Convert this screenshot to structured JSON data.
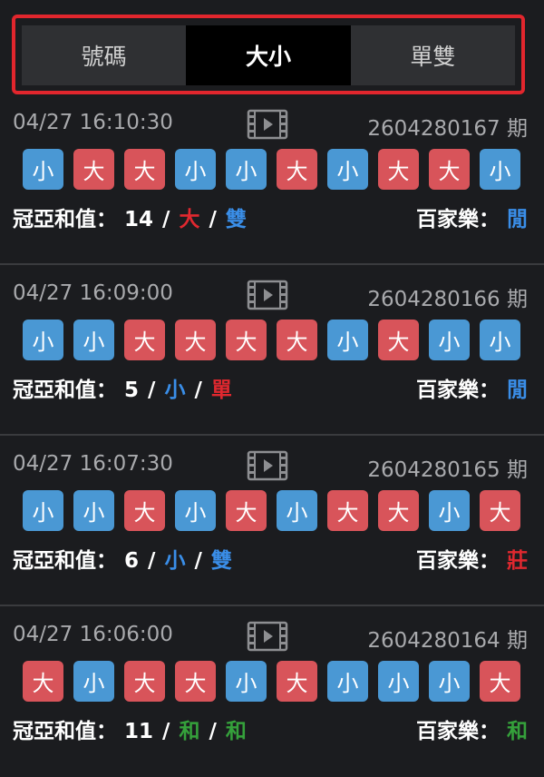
{
  "tabs": [
    {
      "label": "號碼",
      "active": false
    },
    {
      "label": "大小",
      "active": true
    },
    {
      "label": "單雙",
      "active": false
    }
  ],
  "labels": {
    "sum_label": "冠亞和值：",
    "baccarat_label": "百家樂：",
    "period_suffix": "期"
  },
  "colors": {
    "big": "#d8545a",
    "small": "#4a98d4",
    "red_text": "#e0282f",
    "blue_text": "#3a8ee8",
    "green_text": "#35a13b",
    "tab_highlight_border": "#e2262d"
  },
  "rounds": [
    {
      "time": "04/27 16:10:30",
      "period": "2604280167",
      "balls": [
        "小",
        "大",
        "大",
        "小",
        "小",
        "大",
        "小",
        "大",
        "大",
        "小"
      ],
      "sum": "14",
      "size": "大",
      "size_color": "red",
      "parity": "雙",
      "parity_color": "blue",
      "baccarat": "閒",
      "baccarat_color": "blue"
    },
    {
      "time": "04/27 16:09:00",
      "period": "2604280166",
      "balls": [
        "小",
        "小",
        "大",
        "大",
        "大",
        "大",
        "小",
        "大",
        "小",
        "小"
      ],
      "sum": "5",
      "size": "小",
      "size_color": "blue",
      "parity": "單",
      "parity_color": "red",
      "baccarat": "閒",
      "baccarat_color": "blue"
    },
    {
      "time": "04/27 16:07:30",
      "period": "2604280165",
      "balls": [
        "小",
        "小",
        "大",
        "小",
        "大",
        "小",
        "大",
        "大",
        "小",
        "大"
      ],
      "sum": "6",
      "size": "小",
      "size_color": "blue",
      "parity": "雙",
      "parity_color": "blue",
      "baccarat": "莊",
      "baccarat_color": "red"
    },
    {
      "time": "04/27 16:06:00",
      "period": "2604280164",
      "balls": [
        "大",
        "小",
        "大",
        "大",
        "小",
        "大",
        "小",
        "小",
        "小",
        "大"
      ],
      "sum": "11",
      "size": "和",
      "size_color": "green",
      "parity": "和",
      "parity_color": "green",
      "baccarat": "和",
      "baccarat_color": "green"
    }
  ]
}
